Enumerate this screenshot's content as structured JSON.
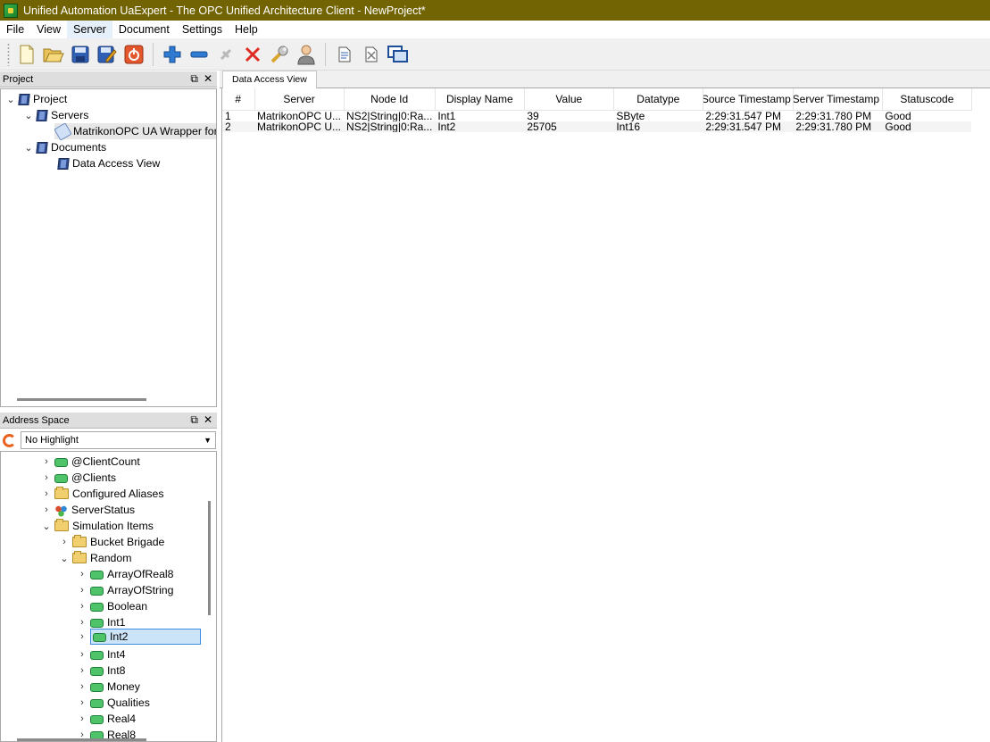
{
  "window": {
    "title": "Unified Automation UaExpert - The OPC Unified Architecture Client - NewProject*"
  },
  "menu": [
    "File",
    "View",
    "Server",
    "Document",
    "Settings",
    "Help"
  ],
  "toolbar": {
    "buttons": [
      "new-project-icon",
      "open-project-icon",
      "save-project-icon",
      "save-as-icon",
      "disconnect-icon",
      "add-server-icon",
      "remove-server-icon",
      "connect-icon",
      "delete-icon",
      "settings-wrench-icon",
      "user-icon",
      "add-document-icon",
      "remove-document-icon",
      "window-icon"
    ]
  },
  "project_panel": {
    "title": "Project",
    "tree": {
      "project": "Project",
      "servers": "Servers",
      "server_item": "MatrikonOPC UA Wrapper for",
      "documents": "Documents",
      "document_item": "Data Access View"
    }
  },
  "address_panel": {
    "title": "Address Space",
    "filter": "No Highlight",
    "items": {
      "client_count": "@ClientCount",
      "clients": "@Clients",
      "configured_aliases": "Configured Aliases",
      "server_status": "ServerStatus",
      "simulation_items": "Simulation Items",
      "bucket_brigade": "Bucket Brigade",
      "random": "Random",
      "array_of_real8": "ArrayOfReal8",
      "array_of_string": "ArrayOfString",
      "boolean": "Boolean",
      "int1": "Int1",
      "int2": "Int2",
      "int4": "Int4",
      "int8": "Int8",
      "money": "Money",
      "qualities": "Qualities",
      "real4": "Real4",
      "real8_partial": "Real8"
    }
  },
  "main": {
    "tab": "Data Access View",
    "columns": [
      "#",
      "Server",
      "Node Id",
      "Display Name",
      "Value",
      "Datatype",
      "Source Timestamp",
      "Server Timestamp",
      "Statuscode"
    ],
    "rows": [
      [
        "1",
        "MatrikonOPC U...",
        "NS2|String|0:Ra...",
        "Int1",
        "39",
        "SByte",
        "2:29:31.547 PM",
        "2:29:31.780 PM",
        "Good"
      ],
      [
        "2",
        "MatrikonOPC U...",
        "NS2|String|0:Ra...",
        "Int2",
        "25705",
        "Int16",
        "2:29:31.547 PM",
        "2:29:31.780 PM",
        "Good"
      ]
    ]
  },
  "colors": {
    "titlebar": "#736403",
    "selection": "#cce4f7",
    "selection_border": "#3d8ee3"
  }
}
